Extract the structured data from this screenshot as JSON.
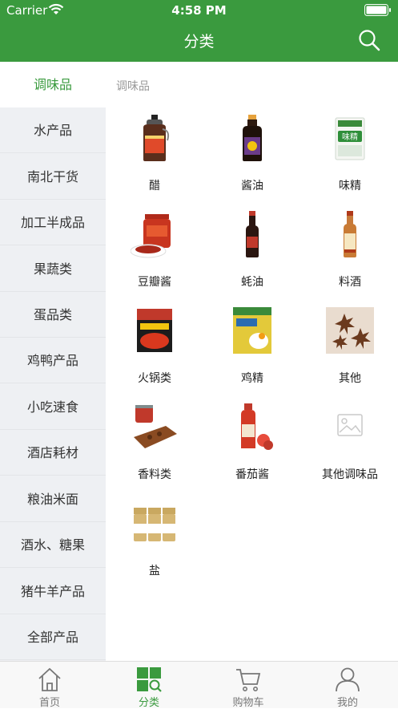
{
  "status_bar": {
    "carrier": "Carrier",
    "time": "4:58 PM"
  },
  "header": {
    "title": "分类",
    "search_icon": "search-icon"
  },
  "colors": {
    "brand": "#3a9a3e",
    "sidebar_bg": "#eef0f3"
  },
  "sidebar": {
    "items": [
      {
        "label": "调味品",
        "active": true
      },
      {
        "label": "水产品"
      },
      {
        "label": "南北干货"
      },
      {
        "label": "加工半成品"
      },
      {
        "label": "果蔬类"
      },
      {
        "label": "蛋品类"
      },
      {
        "label": "鸡鸭产品"
      },
      {
        "label": "小吃速食"
      },
      {
        "label": "酒店耗材"
      },
      {
        "label": "粮油米面"
      },
      {
        "label": "酒水、糖果"
      },
      {
        "label": "猪牛羊产品"
      },
      {
        "label": "全部产品"
      }
    ]
  },
  "main": {
    "section_title": "调味品",
    "products": [
      {
        "name": "醋",
        "icon": "vinegar-bottle-icon"
      },
      {
        "name": "酱油",
        "icon": "soy-sauce-bottle-icon"
      },
      {
        "name": "味精",
        "icon": "msg-bag-icon"
      },
      {
        "name": "豆瓣酱",
        "icon": "bean-paste-jar-icon"
      },
      {
        "name": "蚝油",
        "icon": "oyster-sauce-bottle-icon"
      },
      {
        "name": "料酒",
        "icon": "cooking-wine-bottle-icon"
      },
      {
        "name": "火锅类",
        "icon": "hotpot-base-pack-icon"
      },
      {
        "name": "鸡精",
        "icon": "chicken-essence-bag-icon"
      },
      {
        "name": "其他",
        "icon": "star-anise-icon"
      },
      {
        "name": "香料类",
        "icon": "spices-icon"
      },
      {
        "name": "番茄酱",
        "icon": "ketchup-bottle-icon"
      },
      {
        "name": "其他调味品",
        "icon": "image-placeholder-icon"
      },
      {
        "name": "盐",
        "icon": "salt-jars-icon"
      }
    ]
  },
  "tabbar": {
    "tabs": [
      {
        "label": "首页",
        "icon": "home-icon"
      },
      {
        "label": "分类",
        "icon": "category-grid-icon",
        "active": true
      },
      {
        "label": "购物车",
        "icon": "cart-icon"
      },
      {
        "label": "我的",
        "icon": "user-icon"
      }
    ]
  }
}
